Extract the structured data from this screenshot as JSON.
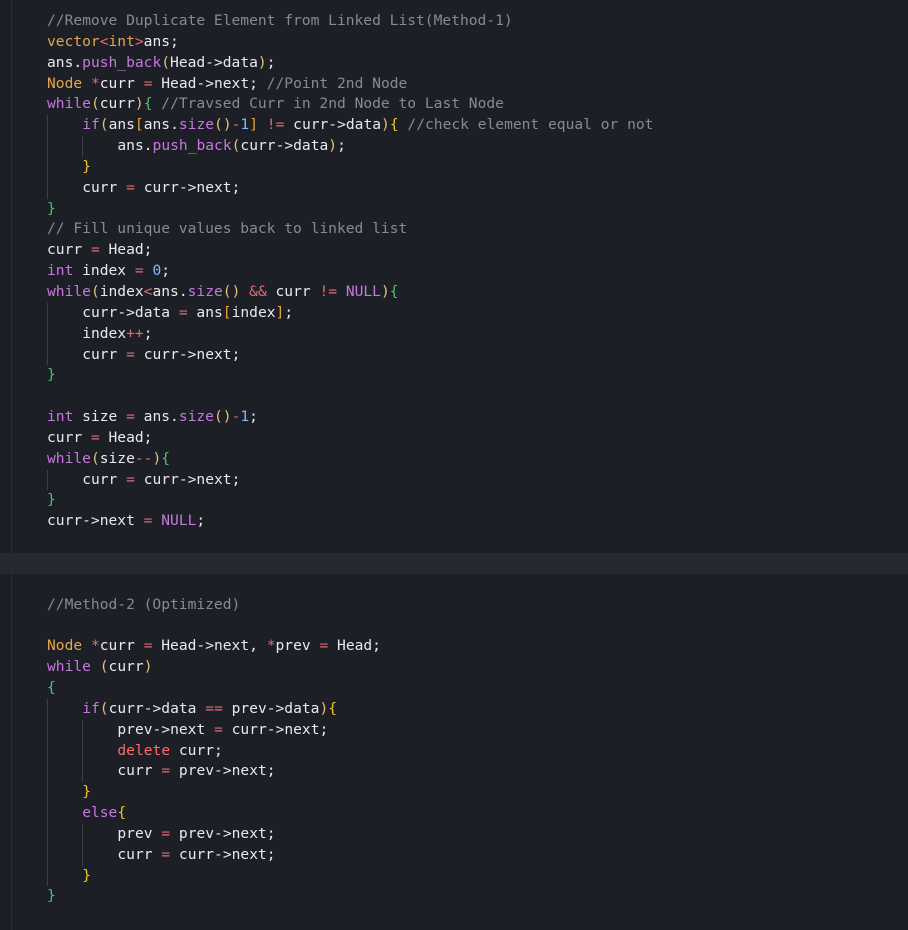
{
  "editor": {
    "lines": [
      {
        "indent": 0,
        "guides": [],
        "tokens": [
          [
            "comment",
            "//Remove Duplicate Element from Linked List(Method-1)"
          ]
        ]
      },
      {
        "indent": 0,
        "guides": [],
        "tokens": [
          [
            "type",
            "vector"
          ],
          [
            "operator",
            "<"
          ],
          [
            "type",
            "int"
          ],
          [
            "operator",
            ">"
          ],
          [
            "plain",
            "ans;"
          ]
        ]
      },
      {
        "indent": 0,
        "guides": [],
        "tokens": [
          [
            "plain",
            "ans."
          ],
          [
            "function",
            "push_back"
          ],
          [
            "paren-y",
            "("
          ],
          [
            "plain",
            "Head->data"
          ],
          [
            "paren-y",
            ")"
          ],
          [
            "plain",
            ";"
          ]
        ]
      },
      {
        "indent": 0,
        "guides": [],
        "tokens": [
          [
            "type",
            "Node"
          ],
          [
            "plain",
            " "
          ],
          [
            "operator",
            "*"
          ],
          [
            "plain",
            "curr "
          ],
          [
            "operator",
            "="
          ],
          [
            "plain",
            " Head->next; "
          ],
          [
            "comment",
            "//Point 2nd Node"
          ]
        ]
      },
      {
        "indent": 0,
        "guides": [],
        "tokens": [
          [
            "control",
            "while"
          ],
          [
            "paren-y",
            "("
          ],
          [
            "plain",
            "curr"
          ],
          [
            "paren-y",
            ")"
          ],
          [
            "brace-g",
            "{"
          ],
          [
            "plain",
            " "
          ],
          [
            "comment",
            "//Travsed Curr in 2nd Node to Last Node"
          ]
        ]
      },
      {
        "indent": 1,
        "guides": [
          0
        ],
        "tokens": [
          [
            "control",
            "if"
          ],
          [
            "paren-y",
            "("
          ],
          [
            "plain",
            "ans"
          ],
          [
            "bracket",
            "["
          ],
          [
            "plain",
            "ans."
          ],
          [
            "function",
            "size"
          ],
          [
            "paren-y",
            "()"
          ],
          [
            "operator",
            "-"
          ],
          [
            "number",
            "1"
          ],
          [
            "bracket",
            "]"
          ],
          [
            "plain",
            " "
          ],
          [
            "operator",
            "!="
          ],
          [
            "plain",
            " curr->data"
          ],
          [
            "paren-y",
            ")"
          ],
          [
            "brace-y",
            "{"
          ],
          [
            "plain",
            " "
          ],
          [
            "comment",
            "//check element equal or not"
          ]
        ]
      },
      {
        "indent": 2,
        "guides": [
          0,
          1
        ],
        "tokens": [
          [
            "plain",
            "ans."
          ],
          [
            "function",
            "push_back"
          ],
          [
            "paren-y",
            "("
          ],
          [
            "plain",
            "curr->data"
          ],
          [
            "paren-y",
            ")"
          ],
          [
            "plain",
            ";"
          ]
        ]
      },
      {
        "indent": 1,
        "guides": [
          0
        ],
        "tokens": [
          [
            "brace-y",
            "}"
          ]
        ]
      },
      {
        "indent": 1,
        "guides": [
          0
        ],
        "tokens": [
          [
            "plain",
            "curr "
          ],
          [
            "operator",
            "="
          ],
          [
            "plain",
            " curr->next;"
          ]
        ]
      },
      {
        "indent": 0,
        "guides": [],
        "tokens": [
          [
            "brace-g",
            "}"
          ]
        ]
      },
      {
        "indent": 0,
        "guides": [],
        "tokens": [
          [
            "comment",
            "// Fill unique values back to linked list"
          ]
        ]
      },
      {
        "indent": 0,
        "guides": [],
        "tokens": [
          [
            "plain",
            "curr "
          ],
          [
            "operator",
            "="
          ],
          [
            "plain",
            " Head;"
          ]
        ]
      },
      {
        "indent": 0,
        "guides": [],
        "tokens": [
          [
            "keyword",
            "int"
          ],
          [
            "plain",
            " index "
          ],
          [
            "operator",
            "="
          ],
          [
            "plain",
            " "
          ],
          [
            "number",
            "0"
          ],
          [
            "plain",
            ";"
          ]
        ]
      },
      {
        "indent": 0,
        "guides": [],
        "tokens": [
          [
            "control",
            "while"
          ],
          [
            "paren-y",
            "("
          ],
          [
            "plain",
            "index"
          ],
          [
            "operator",
            "<"
          ],
          [
            "plain",
            "ans."
          ],
          [
            "function",
            "size"
          ],
          [
            "paren-y",
            "()"
          ],
          [
            "plain",
            " "
          ],
          [
            "operator",
            "&&"
          ],
          [
            "plain",
            " curr "
          ],
          [
            "operator",
            "!="
          ],
          [
            "plain",
            " "
          ],
          [
            "constant",
            "NULL"
          ],
          [
            "paren-y",
            ")"
          ],
          [
            "brace-g",
            "{"
          ]
        ]
      },
      {
        "indent": 1,
        "guides": [
          0
        ],
        "tokens": [
          [
            "plain",
            "curr->data "
          ],
          [
            "operator",
            "="
          ],
          [
            "plain",
            " ans"
          ],
          [
            "bracket",
            "["
          ],
          [
            "plain",
            "index"
          ],
          [
            "bracket",
            "]"
          ],
          [
            "plain",
            ";"
          ]
        ]
      },
      {
        "indent": 1,
        "guides": [
          0
        ],
        "tokens": [
          [
            "plain",
            "index"
          ],
          [
            "operator",
            "++"
          ],
          [
            "plain",
            ";"
          ]
        ]
      },
      {
        "indent": 1,
        "guides": [
          0
        ],
        "tokens": [
          [
            "plain",
            "curr "
          ],
          [
            "operator",
            "="
          ],
          [
            "plain",
            " curr->next;"
          ]
        ]
      },
      {
        "indent": 0,
        "guides": [],
        "tokens": [
          [
            "brace-g",
            "}"
          ]
        ]
      },
      {
        "indent": 0,
        "guides": [],
        "tokens": []
      },
      {
        "indent": 0,
        "guides": [],
        "tokens": [
          [
            "keyword",
            "int"
          ],
          [
            "plain",
            " size "
          ],
          [
            "operator",
            "="
          ],
          [
            "plain",
            " ans."
          ],
          [
            "function",
            "size"
          ],
          [
            "paren-y",
            "()"
          ],
          [
            "operator",
            "-"
          ],
          [
            "number",
            "1"
          ],
          [
            "plain",
            ";"
          ]
        ]
      },
      {
        "indent": 0,
        "guides": [],
        "tokens": [
          [
            "plain",
            "curr "
          ],
          [
            "operator",
            "="
          ],
          [
            "plain",
            " Head;"
          ]
        ]
      },
      {
        "indent": 0,
        "guides": [],
        "tokens": [
          [
            "control",
            "while"
          ],
          [
            "paren-y",
            "("
          ],
          [
            "plain",
            "size"
          ],
          [
            "operator",
            "--"
          ],
          [
            "paren-y",
            ")"
          ],
          [
            "brace-g",
            "{"
          ]
        ]
      },
      {
        "indent": 1,
        "guides": [
          0
        ],
        "tokens": [
          [
            "plain",
            "curr "
          ],
          [
            "operator",
            "="
          ],
          [
            "plain",
            " curr->next;"
          ]
        ]
      },
      {
        "indent": 0,
        "guides": [],
        "tokens": [
          [
            "brace-g",
            "}"
          ]
        ]
      },
      {
        "indent": 0,
        "guides": [],
        "tokens": [
          [
            "plain",
            "curr->next "
          ],
          [
            "operator",
            "="
          ],
          [
            "plain",
            " "
          ],
          [
            "constant",
            "NULL"
          ],
          [
            "plain",
            ";"
          ]
        ]
      },
      {
        "indent": 0,
        "guides": [],
        "tokens": []
      },
      {
        "indent": 0,
        "guides": [],
        "highlight": true,
        "tokens": []
      },
      {
        "indent": 0,
        "guides": [],
        "tokens": []
      },
      {
        "indent": 0,
        "guides": [],
        "tokens": [
          [
            "comment",
            "//Method-2 (Optimized)"
          ]
        ]
      },
      {
        "indent": 0,
        "guides": [],
        "tokens": []
      },
      {
        "indent": 0,
        "guides": [],
        "tokens": [
          [
            "type",
            "Node"
          ],
          [
            "plain",
            " "
          ],
          [
            "operator",
            "*"
          ],
          [
            "plain",
            "curr "
          ],
          [
            "operator",
            "="
          ],
          [
            "plain",
            " Head->next, "
          ],
          [
            "operator",
            "*"
          ],
          [
            "plain",
            "prev "
          ],
          [
            "operator",
            "="
          ],
          [
            "plain",
            " Head;"
          ]
        ]
      },
      {
        "indent": 0,
        "guides": [],
        "tokens": [
          [
            "control",
            "while"
          ],
          [
            "plain",
            " "
          ],
          [
            "paren-y",
            "("
          ],
          [
            "plain",
            "curr"
          ],
          [
            "paren-y",
            ")"
          ]
        ]
      },
      {
        "indent": 0,
        "guides": [],
        "tokens": [
          [
            "brace-g",
            "{"
          ]
        ]
      },
      {
        "indent": 1,
        "guides": [
          0
        ],
        "tokens": [
          [
            "control",
            "if"
          ],
          [
            "paren-y",
            "("
          ],
          [
            "plain",
            "curr->data "
          ],
          [
            "operator",
            "=="
          ],
          [
            "plain",
            " prev->data"
          ],
          [
            "paren-y",
            ")"
          ],
          [
            "brace-y",
            "{"
          ]
        ]
      },
      {
        "indent": 2,
        "guides": [
          0,
          1
        ],
        "tokens": [
          [
            "plain",
            "prev->next "
          ],
          [
            "operator",
            "="
          ],
          [
            "plain",
            " curr->next;"
          ]
        ]
      },
      {
        "indent": 2,
        "guides": [
          0,
          1
        ],
        "tokens": [
          [
            "delete",
            "delete"
          ],
          [
            "plain",
            " curr;"
          ]
        ]
      },
      {
        "indent": 2,
        "guides": [
          0,
          1
        ],
        "tokens": [
          [
            "plain",
            "curr "
          ],
          [
            "operator",
            "="
          ],
          [
            "plain",
            " prev->next;"
          ]
        ]
      },
      {
        "indent": 1,
        "guides": [
          0
        ],
        "tokens": [
          [
            "brace-y",
            "}"
          ]
        ]
      },
      {
        "indent": 1,
        "guides": [
          0
        ],
        "tokens": [
          [
            "control",
            "else"
          ],
          [
            "brace-y",
            "{"
          ]
        ]
      },
      {
        "indent": 2,
        "guides": [
          0,
          1
        ],
        "tokens": [
          [
            "plain",
            "prev "
          ],
          [
            "operator",
            "="
          ],
          [
            "plain",
            " prev->next;"
          ]
        ]
      },
      {
        "indent": 2,
        "guides": [
          0,
          1
        ],
        "tokens": [
          [
            "plain",
            "curr "
          ],
          [
            "operator",
            "="
          ],
          [
            "plain",
            " curr->next;"
          ]
        ]
      },
      {
        "indent": 1,
        "guides": [
          0
        ],
        "tokens": [
          [
            "brace-y",
            "}"
          ]
        ]
      },
      {
        "indent": 0,
        "guides": [],
        "tokens": [
          [
            "brace-g",
            "}"
          ]
        ]
      }
    ]
  }
}
